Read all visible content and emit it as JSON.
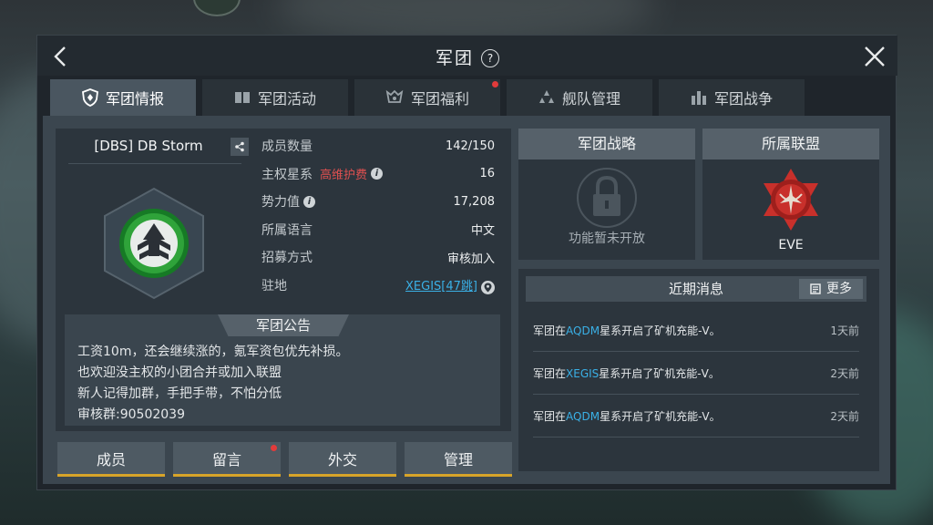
{
  "window": {
    "title": "军团"
  },
  "tabs": [
    {
      "label": "军团情报"
    },
    {
      "label": "军团活动"
    },
    {
      "label": "军团福利"
    },
    {
      "label": "舰队管理"
    },
    {
      "label": "军团战争"
    }
  ],
  "guild": {
    "name": "[DBS] DB Storm",
    "info": {
      "members_label": "成员数量",
      "members_value": "142/150",
      "sovereign_label": "主权星系",
      "sovereign_warning": "高维护费",
      "sovereign_value": "16",
      "power_label": "势力值",
      "power_value": "17,208",
      "language_label": "所属语言",
      "language_value": "中文",
      "recruit_label": "招募方式",
      "recruit_value": "审核加入",
      "base_label": "驻地",
      "base_value": "XEGIS[47跳]"
    },
    "notice": {
      "title": "军团公告",
      "lines": [
        "工资10m，还会继续涨的，氪军资包优先补损。",
        "也欢迎没主权的小团合并或加入联盟",
        "新人记得加群，手把手带，不怕分低",
        "审核群:90502039"
      ]
    }
  },
  "actions": {
    "members": "成员",
    "messages": "留言",
    "diplomacy": "外交",
    "manage": "管理"
  },
  "strategy": {
    "title": "军团战略",
    "status": "功能暂未开放"
  },
  "alliance": {
    "title": "所属联盟",
    "name": "EVE"
  },
  "news": {
    "title": "近期消息",
    "more_label": "更多",
    "items": [
      {
        "prefix": "军团在",
        "system": "AQDM",
        "suffix": "星系开启了矿机充能-V。",
        "time": "1天前"
      },
      {
        "prefix": "军团在",
        "system": "XEGIS",
        "suffix": "星系开启了矿机充能-V。",
        "time": "2天前"
      },
      {
        "prefix": "军团在",
        "system": "AQDM",
        "suffix": "星系开启了矿机充能-V。",
        "time": "2天前"
      }
    ]
  },
  "colors": {
    "accent_gold": "#d7a429",
    "alert_red": "#e23b3b",
    "link_blue": "#3ab0e6",
    "emblem_green": "#2fa33a",
    "alliance_red": "#c8302b"
  }
}
